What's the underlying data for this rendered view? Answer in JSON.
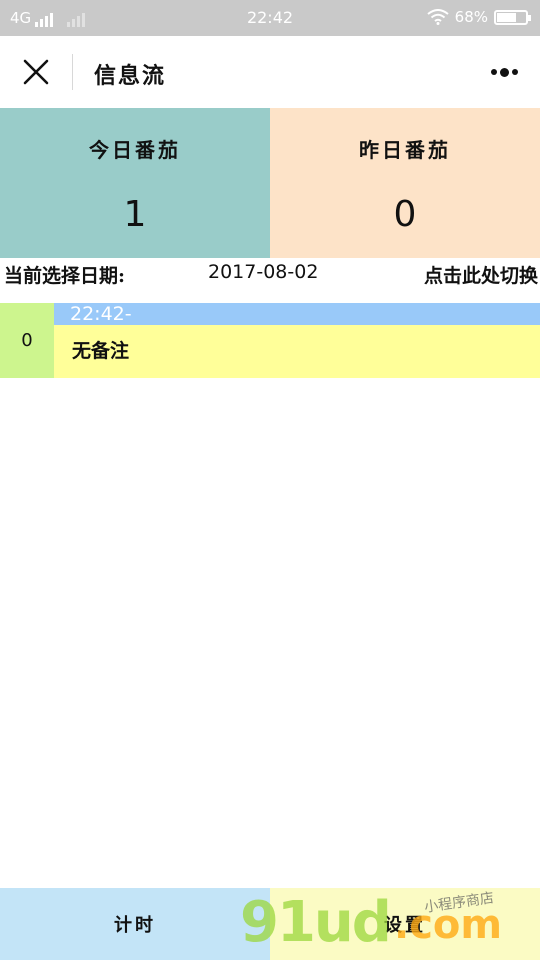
{
  "status_bar": {
    "network": "4G",
    "time": "22:42",
    "battery_percent": "68%",
    "battery_level": 0.68,
    "icons": [
      "signal-icon",
      "wifi-icon",
      "battery-icon"
    ]
  },
  "nav": {
    "title": "信息流",
    "close_icon": "close-icon",
    "more_icon": "more-icon"
  },
  "stats": {
    "today_label": "今日番茄",
    "today_value": "1",
    "yesterday_label": "昨日番茄",
    "yesterday_value": "0"
  },
  "date_row": {
    "label": "当前选择日期:",
    "value": "2017-08-02",
    "switch_label": "点击此处切换"
  },
  "records": [
    {
      "index": "0",
      "time": "22:42-",
      "note": "无备注"
    }
  ],
  "tabs": {
    "timer_label": "计时",
    "settings_label": "设置"
  },
  "watermark": {
    "main": "91ud",
    "suffix": ".com",
    "tagline": "小程序商店"
  },
  "colors": {
    "status_bar": "#c9c9c9",
    "today_bg": "#99ccc9",
    "yesterday_bg": "#fde3c8",
    "record_index_bg": "#cdf58e",
    "record_time_bg": "#99c9f9",
    "record_note_bg": "#ffff99",
    "tab_timer_bg": "#c3e4f7",
    "tab_settings_bg": "#fbfbc4"
  }
}
